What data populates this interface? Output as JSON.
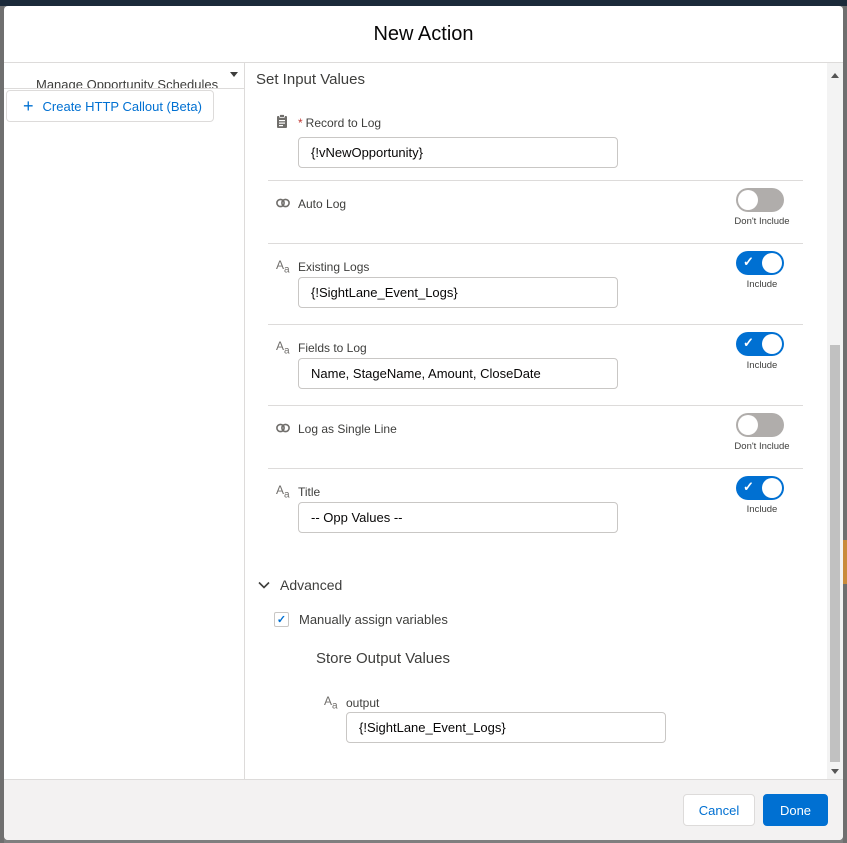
{
  "modal": {
    "title": "New Action"
  },
  "left_pane": {
    "clipped_select_text": "Manage Opportunity Schedules",
    "create_http_callout_label": "Create HTTP Callout (Beta)"
  },
  "input_values": {
    "section_title": "Set Input Values",
    "fields": [
      {
        "icon": "clipboard-icon",
        "required_marker": "*",
        "label": "Record to Log",
        "value": "{!vNewOpportunity}"
      },
      {
        "icon": "toggle-icon",
        "label": "Auto Log",
        "toggle_state": "off",
        "toggle_caption": "Don't Include"
      },
      {
        "icon": "text-icon",
        "label": "Existing Logs",
        "value": "{!SightLane_Event_Logs}",
        "toggle_state": "on",
        "toggle_caption": "Include"
      },
      {
        "icon": "text-icon",
        "label": "Fields to Log",
        "value": "Name, StageName, Amount, CloseDate",
        "toggle_state": "on",
        "toggle_caption": "Include"
      },
      {
        "icon": "toggle-icon",
        "label": "Log as Single Line",
        "toggle_state": "off",
        "toggle_caption": "Don't Include"
      },
      {
        "icon": "text-icon",
        "label": "Title",
        "value": "-- Opp Values --",
        "toggle_state": "on",
        "toggle_caption": "Include"
      }
    ]
  },
  "advanced": {
    "label": "Advanced",
    "manual_assign_label": "Manually assign variables",
    "manual_assign_checked": true
  },
  "output_values": {
    "section_title": "Store Output Values",
    "fields": [
      {
        "icon": "text-icon",
        "label": "output",
        "value": "{!SightLane_Event_Logs}"
      }
    ]
  },
  "footer": {
    "cancel_label": "Cancel",
    "done_label": "Done"
  },
  "icons": {
    "text_glyph": "A",
    "text_sub_glyph": "a",
    "toggle_glyph": "∞",
    "check_glyph": "✓",
    "plus_glyph": "+",
    "chevron_glyph": "⌄"
  },
  "colors": {
    "brand": "#0070d2",
    "toggle_off": "#b0adab",
    "required": "#c23934"
  }
}
